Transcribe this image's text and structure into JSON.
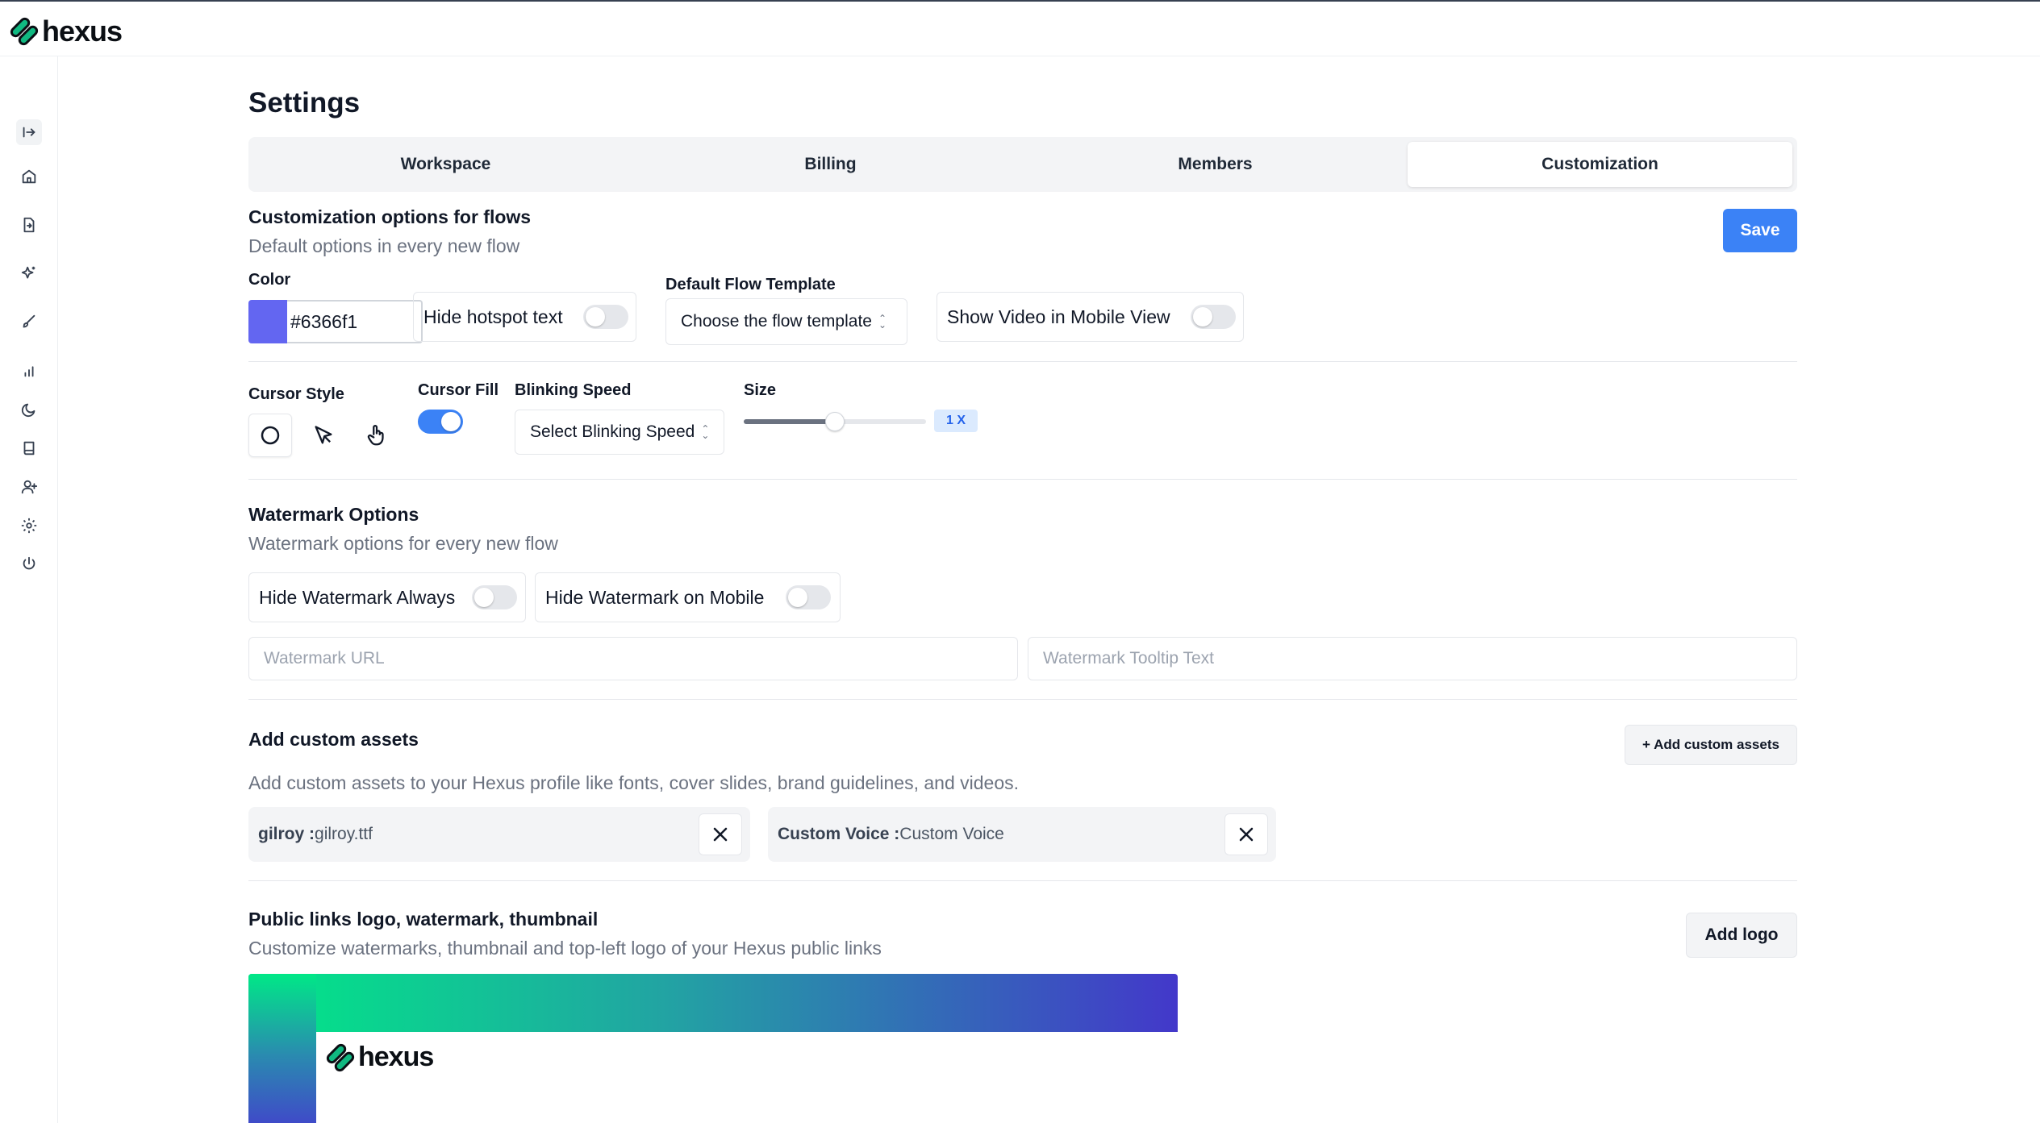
{
  "brand": {
    "name": "hexus"
  },
  "sidebar": {
    "items": [
      {
        "icon": "collapse-arrow-icon"
      },
      {
        "icon": "home-icon"
      },
      {
        "icon": "file-share-icon"
      },
      {
        "icon": "sparkles-icon"
      },
      {
        "icon": "brush-icon"
      },
      {
        "icon": "bar-chart-icon"
      },
      {
        "icon": "moon-icon"
      },
      {
        "icon": "book-icon"
      },
      {
        "icon": "user-plus-icon"
      },
      {
        "icon": "gear-icon"
      },
      {
        "icon": "power-icon"
      }
    ]
  },
  "page": {
    "title": "Settings"
  },
  "tabs": [
    {
      "label": "Workspace",
      "active": false
    },
    {
      "label": "Billing",
      "active": false
    },
    {
      "label": "Members",
      "active": false
    },
    {
      "label": "Customization",
      "active": true
    }
  ],
  "customization": {
    "title": "Customization options for flows",
    "subtitle": "Default options in every new flow",
    "save_label": "Save",
    "color_label": "Color",
    "color_value": "#6366f1",
    "hide_hotspot_label": "Hide hotspot text",
    "hide_hotspot_on": false,
    "template_label": "Default Flow Template",
    "template_placeholder": "Choose the flow template",
    "show_video_label": "Show Video in Mobile View",
    "show_video_on": false
  },
  "cursor": {
    "style_label": "Cursor Style",
    "fill_label": "Cursor Fill",
    "fill_on": true,
    "blink_label": "Blinking Speed",
    "blink_placeholder": "Select Blinking Speed",
    "size_label": "Size",
    "size_value": "1 X",
    "size_fraction": 0.5
  },
  "watermark": {
    "title": "Watermark Options",
    "subtitle": "Watermark options for every new flow",
    "hide_always_label": "Hide Watermark Always",
    "hide_always_on": false,
    "hide_mobile_label": "Hide Watermark on Mobile",
    "hide_mobile_on": false,
    "url_placeholder": "Watermark URL",
    "tooltip_placeholder": "Watermark Tooltip Text"
  },
  "assets": {
    "title": "Add custom assets",
    "add_label": "+ Add custom assets",
    "description": "Add custom assets to your Hexus profile like fonts, cover slides, brand guidelines, and videos.",
    "items": [
      {
        "key": "gilroy :",
        "value": " gilroy.ttf"
      },
      {
        "key": "Custom Voice :",
        "value": " Custom Voice"
      }
    ]
  },
  "public_links": {
    "title": "Public links logo, watermark, thumbnail",
    "subtitle": "Customize watermarks, thumbnail and top-left logo of your Hexus public links",
    "add_logo_label": "Add logo",
    "preview_logo_text": "hexus"
  },
  "colors": {
    "accent": "#3b82f6",
    "swatch": "#6366f1"
  }
}
